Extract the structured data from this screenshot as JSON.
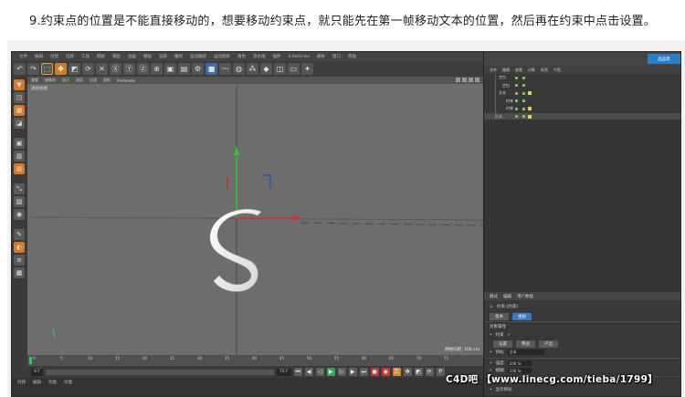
{
  "caption": "9.约束点的位置是不能直接移动的，想要移动约束点，就只能先在第一帧移动文本的位置，然后再在约束中点击设置。",
  "menubar": [
    "文件",
    "编辑",
    "创建",
    "选择",
    "工具",
    "网格",
    "捕捉",
    "动画",
    "模拟",
    "渲染",
    "雕刻",
    "运动跟踪",
    "运动图形",
    "角色",
    "流水线",
    "插件",
    "X-Particles",
    "脚本",
    "窗口",
    "帮助"
  ],
  "viewport": {
    "menu": [
      "查看",
      "摄像机",
      "显示",
      "选项",
      "过滤",
      "面板",
      "ProRender"
    ],
    "label": "透视视图",
    "grid_info": "网格间距: 100 cm"
  },
  "timeline": {
    "ticks": [
      "0",
      "5",
      "10",
      "15",
      "20",
      "25",
      "30",
      "35",
      "40",
      "45",
      "50",
      "55",
      "60",
      "65",
      "70",
      "75"
    ]
  },
  "playbar": {
    "start": "0 F",
    "end": "75 F",
    "current": "0 F"
  },
  "matbar": [
    "创建",
    "编辑",
    "功能",
    "纹理"
  ],
  "rightpanel": {
    "logo": "品品黑",
    "om_menu": [
      "文件",
      "编辑",
      "查看",
      "对象",
      "标签",
      "书签"
    ],
    "objects": [
      {
        "name": "空白"
      },
      {
        "name": "空白"
      },
      {
        "name": "文本"
      },
      {
        "name": "约束"
      },
      {
        "name": "约束"
      },
      {
        "name": "文本"
      }
    ],
    "attr_tabs": [
      "模式",
      "编辑",
      "用户数据"
    ],
    "attr_title": "约束 [约束]",
    "attr_tabs2": [
      "基本",
      "坐标"
    ],
    "section": "对象属性",
    "rows": [
      {
        "label": "约束"
      },
      {
        "label": "设置",
        "btn2": "释放",
        "btn3": "产出"
      },
      {
        "label": "目标",
        "value": "文本"
      },
      {
        "label": "强度",
        "value": "100 %"
      },
      {
        "label": "模糊",
        "value": "100 %"
      },
      {
        "label": "显示边框"
      },
      {
        "label": "显示目标"
      }
    ]
  },
  "watermark": "C4D吧 【www.linecg.com/tieba/1799】",
  "corner_info": "..."
}
